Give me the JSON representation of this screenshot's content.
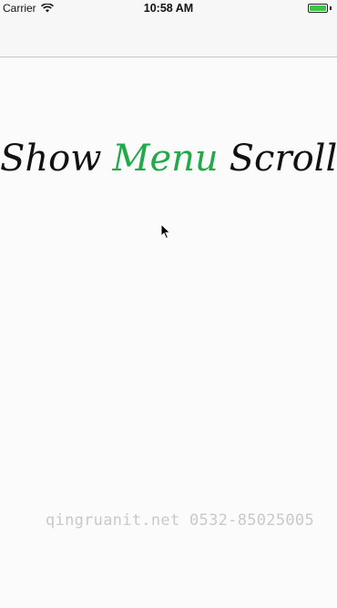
{
  "status_bar": {
    "carrier": "Carrier",
    "time": "10:58 AM",
    "battery_color": "#3ec444"
  },
  "headline": {
    "word1": "Show",
    "word2": "Menu",
    "word3": "Scroll",
    "accent_color": "#21a94a"
  },
  "watermark": {
    "text": "qingruanit.net 0532-85025005"
  }
}
